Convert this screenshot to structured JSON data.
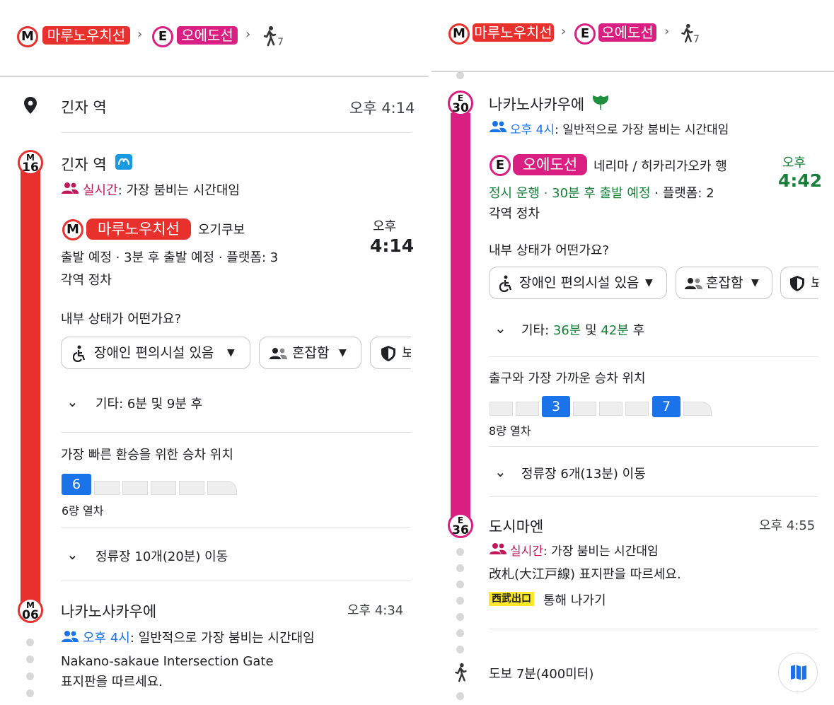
{
  "left": {
    "header": {
      "line1_badge": "M",
      "line1_name": "마루노우치선",
      "line2_badge": "E",
      "line2_name": "오에도선",
      "walk_sub": "7",
      "sep": "›"
    },
    "start": {
      "name": "긴자 역",
      "time": "오후 4:14"
    },
    "station1": {
      "code_l": "M",
      "code_n": "16",
      "name": "긴자 역",
      "crowd_label": "실시간",
      "crowd_text": ": 가장 붐비는 시간대임"
    },
    "train": {
      "badge": "M",
      "line": "마루노우치선",
      "dest": "오기쿠보",
      "status": "출발 예정 · 3분 후 출발 예정 · 플랫폼: 3",
      "type": "각역 정차",
      "time_label": "오후",
      "time": "4:14"
    },
    "question": "내부 상태가 어떤가요?",
    "chips": {
      "accessible": "장애인 편의시설 있음",
      "crowded": "혼잡함",
      "safety": "보"
    },
    "others": "기타: 6분 및 9분 후",
    "boarding_title": "가장 빠른 환승을 위한 승차 위치",
    "boarding_car": "6",
    "train_len": "6량 열차",
    "stops": "정류장 10개(20분) 이동",
    "station2": {
      "code_l": "M",
      "code_n": "06",
      "name": "나카노사카우에",
      "time": "오후 4:34",
      "crowd_label": "오후 4시",
      "crowd_text": ": 일반적으로 가장 붐비는 시간대임"
    },
    "gate_line1": "Nakano-sakaue Intersection Gate",
    "gate_line2": "표지판을 따르세요."
  },
  "right": {
    "header": {
      "line1_badge": "M",
      "line1_name": "마루노우치선",
      "line2_badge": "E",
      "line2_name": "오에도선",
      "walk_sub": "7",
      "sep": "›"
    },
    "station1": {
      "code_l": "E",
      "code_n": "30",
      "name": "나카노사카우에",
      "crowd_label": "오후 4시",
      "crowd_text": ": 일반적으로 가장 붐비는 시간대임"
    },
    "train": {
      "badge": "E",
      "line": "오에도선",
      "dest": "네리마 / 히카리가오카 행",
      "status_green": "정시 운행 · 30분 후 출발 예정",
      "status_rest": " · 플랫폼: 2",
      "type": "각역 정차",
      "time_label": "오후",
      "time": "4:42"
    },
    "question": "내부 상태가 어떤가요?",
    "chips": {
      "accessible": "장애인 편의시설 있음",
      "crowded": "혼잡함",
      "safety": "보"
    },
    "others_prefix": "기타: ",
    "others_a": "36분",
    "others_mid": " 및 ",
    "others_b": "42분",
    "others_suffix": " 후",
    "boarding_title": "출구와 가장 가까운 승차 위치",
    "boarding_car_a": "3",
    "boarding_car_b": "7",
    "train_len": "8량 열차",
    "stops": "정류장 6개(13분) 이동",
    "station2": {
      "code_l": "E",
      "code_n": "36",
      "name": "도시마엔",
      "time": "오후 4:55",
      "crowd_label": "실시간",
      "crowd_text": ": 가장 붐비는 시간대임"
    },
    "exit_instruction": "改札(大江戸線) 표지판을 따르세요.",
    "exit_tag": "西武出口",
    "exit_text": "통해 나가기",
    "walk": "도보 7분(400미터)"
  },
  "colors": {
    "marunouchi": "#e8302c",
    "oedo": "#da1f83",
    "blue": "#1a73e8",
    "green": "#188038"
  }
}
